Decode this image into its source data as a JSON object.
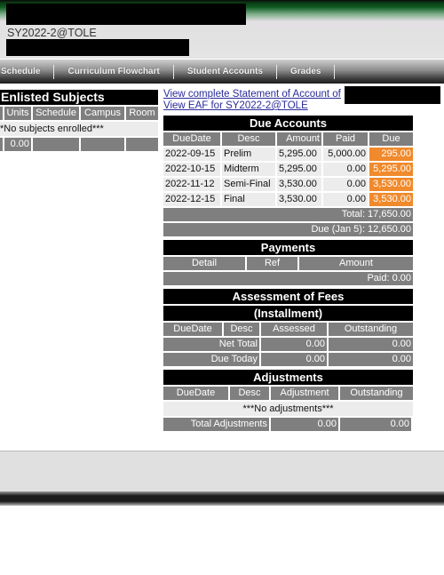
{
  "header": {
    "term": "SY2022-2@TOLE"
  },
  "nav": {
    "items": [
      {
        "label": "Schedule"
      },
      {
        "label": "Curriculum Flowchart"
      },
      {
        "label": "Student Accounts"
      },
      {
        "label": "Grades"
      }
    ]
  },
  "enlisted_subjects": {
    "title": "Enlisted Subjects",
    "columns": [
      "Units",
      "Schedule",
      "Campus",
      "Room"
    ],
    "empty_message": "*No subjects enrolled***",
    "total_units": "0.00"
  },
  "links": {
    "statement_of_account": "View complete Statement of Account of",
    "eaf": "View EAF for SY2022-2@TOLE"
  },
  "due_accounts": {
    "title": "Due Accounts",
    "columns": [
      "DueDate",
      "Desc",
      "Amount",
      "Paid",
      "Due"
    ],
    "rows": [
      {
        "duedate": "2022-09-15",
        "desc": "Prelim",
        "amount": "5,295.00",
        "paid": "5,000.00",
        "due": "295.00"
      },
      {
        "duedate": "2022-10-15",
        "desc": "Midterm",
        "amount": "5,295.00",
        "paid": "0.00",
        "due": "5,295.00"
      },
      {
        "duedate": "2022-11-12",
        "desc": "Semi-Final",
        "amount": "3,530.00",
        "paid": "0.00",
        "due": "3,530.00"
      },
      {
        "duedate": "2022-12-15",
        "desc": "Final",
        "amount": "3,530.00",
        "paid": "0.00",
        "due": "3,530.00"
      }
    ],
    "total": "Total: 17,650.00",
    "due_as_of": "Due (Jan 5): 12,650.00"
  },
  "payments": {
    "title": "Payments",
    "columns": [
      "Detail",
      "Ref",
      "Amount"
    ],
    "paid": "Paid: 0.00"
  },
  "assessment": {
    "title": "Assessment of Fees",
    "subtitle": "(Installment)",
    "columns": [
      "DueDate",
      "Desc",
      "Assessed",
      "Outstanding"
    ],
    "rows": [
      {
        "label": "Net Total",
        "assessed": "0.00",
        "outstanding": "0.00"
      },
      {
        "label": "Due Today",
        "assessed": "0.00",
        "outstanding": "0.00"
      }
    ]
  },
  "adjustments": {
    "title": "Adjustments",
    "columns": [
      "DueDate",
      "Desc",
      "Adjustment",
      "Outstanding"
    ],
    "empty_message": "***No adjustments***",
    "total_label": "Total Adjustments",
    "total_adjustment": "0.00",
    "total_outstanding": "0.00"
  },
  "colors": {
    "accent_due": "#f08a2c",
    "header_green": "#0f5a22",
    "link": "#2a2a9a"
  }
}
